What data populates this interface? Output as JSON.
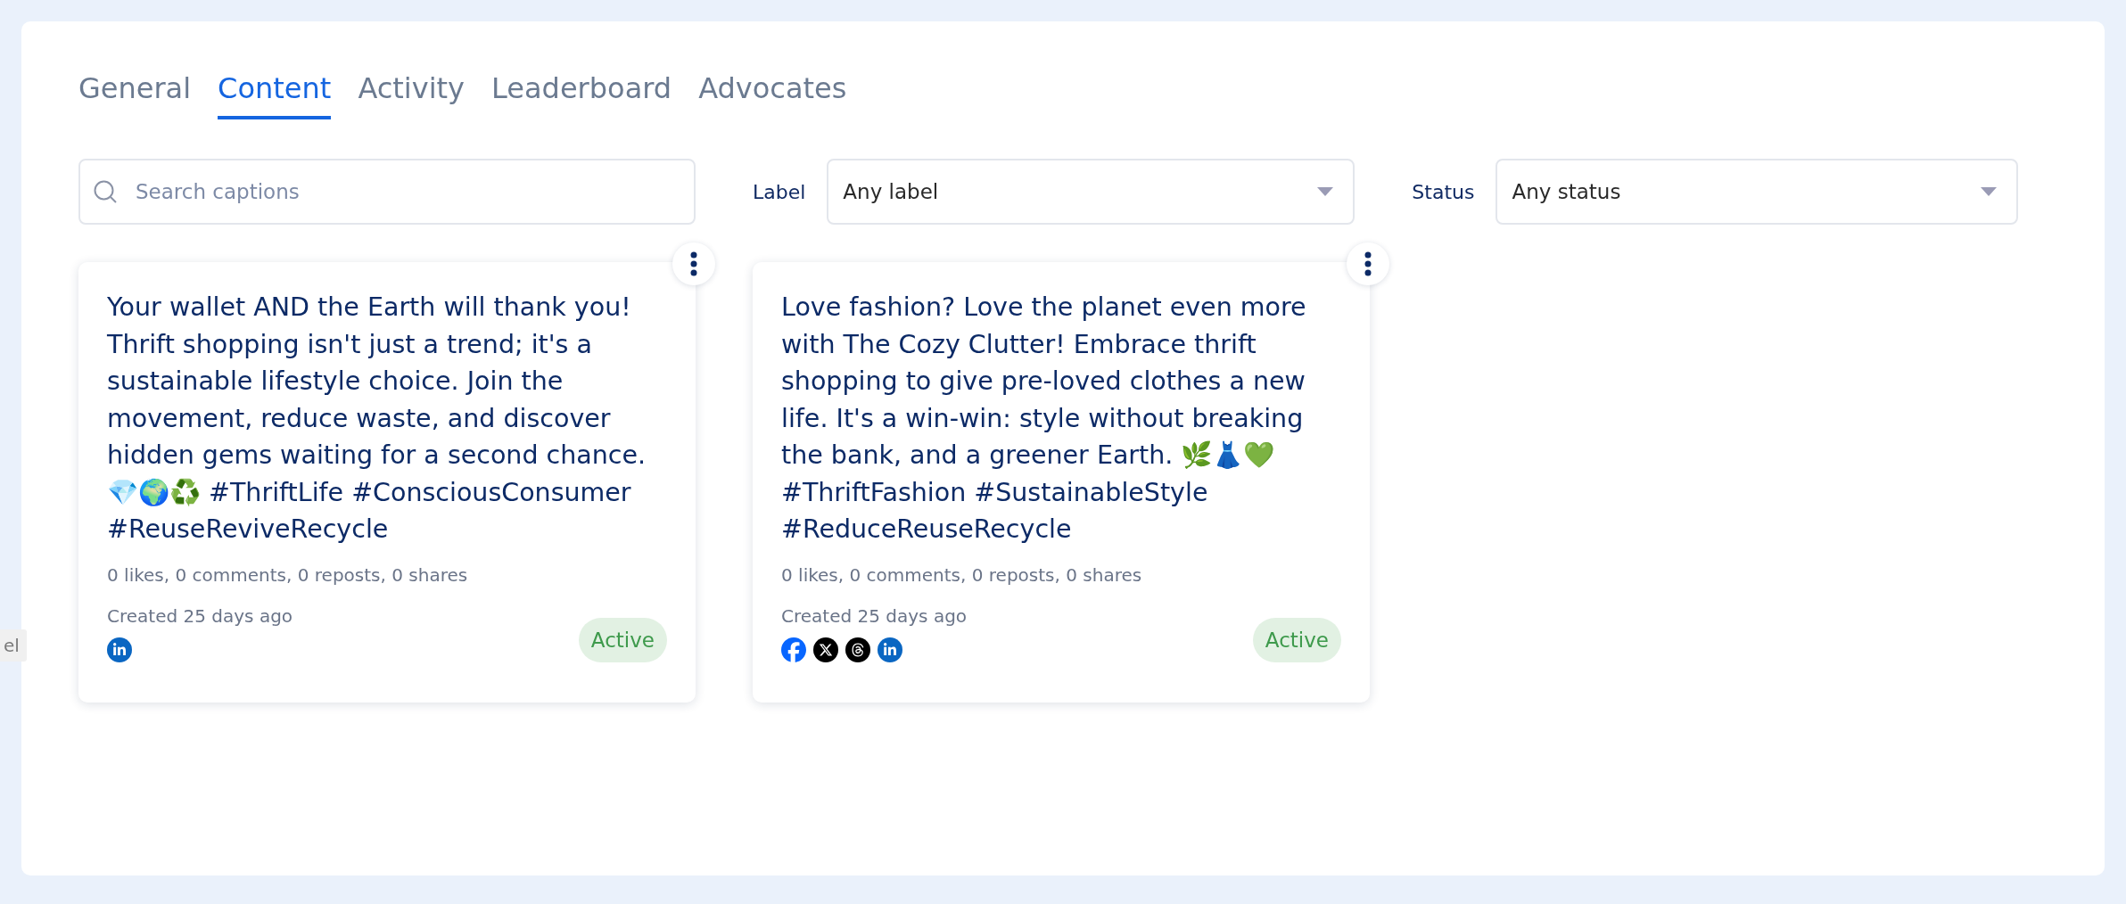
{
  "tabs": [
    {
      "label": "General",
      "selected": false
    },
    {
      "label": "Content",
      "selected": true
    },
    {
      "label": "Activity",
      "selected": false
    },
    {
      "label": "Leaderboard",
      "selected": false
    },
    {
      "label": "Advocates",
      "selected": false
    }
  ],
  "search": {
    "placeholder": "Search captions"
  },
  "filters": [
    {
      "label": "Label",
      "value": "Any label"
    },
    {
      "label": "Status",
      "value": "Any status"
    }
  ],
  "side_chip": "el",
  "posts": [
    {
      "caption": "Your wallet AND the Earth will thank you! Thrift shopping isn't just a trend; it's a sustainable lifestyle choice. Join the movement, reduce waste, and discover hidden gems waiting for a second chance. 💎🌍♻️ #ThriftLife #ConsciousConsumer #ReuseReviveRecycle",
      "stats": "0 likes, 0 comments, 0 reposts, 0 shares",
      "created": "Created 25 days ago",
      "status": "Active",
      "platforms": [
        {
          "kind": "linkedin"
        }
      ]
    },
    {
      "caption": "Love fashion? Love the planet even more with The Cozy Clutter! Embrace thrift shopping to give pre-loved clothes a new life. It's a win-win: style without breaking the bank, and a greener Earth. 🌿👗💚 #ThriftFashion #SustainableStyle #ReduceReuseRecycle",
      "stats": "0 likes, 0 comments, 0 reposts, 0 shares",
      "created": "Created 25 days ago",
      "status": "Active",
      "platforms": [
        {
          "kind": "facebook"
        },
        {
          "kind": "x"
        },
        {
          "kind": "threads"
        },
        {
          "kind": "linkedin"
        }
      ]
    }
  ]
}
